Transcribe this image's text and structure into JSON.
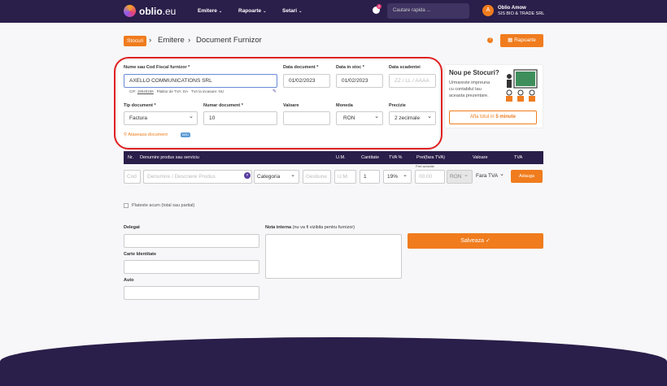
{
  "header": {
    "logo_text_main": "oblio",
    "logo_text_suffix": ".eu",
    "nav": [
      "Emitere",
      "Rapoarte",
      "Setari"
    ],
    "notification_count": "2",
    "search_placeholder": "Cautare rapida ...",
    "user_initial": "A",
    "user_name": "Oblio Amow",
    "company": "SIS BIO & TRADE SRL"
  },
  "breadcrumb": {
    "section": "Stocuri",
    "emitere": "Emitere",
    "page": "Document Furnizor",
    "rapoarte_button": "Rapoarte"
  },
  "form": {
    "furnizor_label": "Nume sau Cod Fiscal furnizor *",
    "furnizor_value": "AXELLO COMMUNICATIONS SRL",
    "cif_label": "CIF:",
    "cif_value": "18040156",
    "platitor_tva": "Platitor de TVA: DA",
    "tva_incasare": "TVA la incasare: NU",
    "data_document_label": "Data document *",
    "data_document_value": "01/02/2023",
    "data_stoc_label": "Data in stoc *",
    "data_stoc_value": "01/02/2023",
    "data_scadenta_label": "Data scadentei",
    "data_scadenta_placeholder": "ZZ / LL / AAAA",
    "tip_document_label": "Tip document *",
    "tip_document_value": "Factura",
    "numar_document_label": "Numar document *",
    "numar_document_value": "10",
    "valoare_label": "Valoare",
    "moneda_label": "Moneda",
    "moneda_value": "RON",
    "precizie_label": "Precizie",
    "precizie_value": "2 zecimale",
    "ataseaza": "Ataseaza document",
    "nou_badge": "NOU"
  },
  "promo": {
    "title": "Nou pe Stocuri?",
    "text1": "Urmareste impreuna",
    "text2": "cu contabilul tau",
    "text3": "aceasta prezentare.",
    "button_pre": "Afla totul in ",
    "button_bold": "5 minute"
  },
  "table": {
    "headers": [
      "Nr.",
      "Denumire produs sau serviciu",
      "U.M.",
      "Cantitate",
      "TVA %",
      "Pret(fara TVA)",
      "Valoare",
      "TVA"
    ],
    "cod_placeholder": "Cod",
    "denumire_placeholder": "Denumire / Descriere Produs",
    "categoria": "Categoria",
    "gestiune_placeholder": "Gestiune",
    "um_placeholder": "U.M.",
    "cantitate_value": "1",
    "tva_value": "19%",
    "pret_achizitie_label": "Pret achizitie",
    "pret_placeholder": "00.00",
    "valuta": "RON",
    "fara_tva": "Fara TVA",
    "adauga": "Adauga"
  },
  "plateste_label": "Plateste acum (total sau partial)",
  "delegat_label": "Delegat",
  "carte_label": "Carte Identitate",
  "auto_label": "Auto",
  "nota_label": "Nota interna",
  "nota_hint": "(nu va fi vizibila pentru furnizor)",
  "salveaza": "Salveaza"
}
